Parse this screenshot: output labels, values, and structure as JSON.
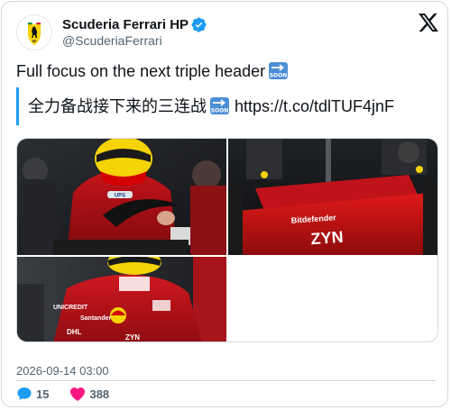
{
  "author": {
    "display_name": "Scuderia Ferrari HP",
    "handle": "@ScuderiaFerrari",
    "verified": true
  },
  "tweet": {
    "text": "Full focus on the next triple header",
    "text_emoji": "soon-arrow",
    "quote_text": "全力备战接下来的三连战",
    "quote_emoji": "soon-arrow",
    "link": "https://t.co/tdlTUF4jnF"
  },
  "media": {
    "car_livery": "Bitdefender",
    "car_sponsor": "ZYN",
    "suit_sponsors": [
      "Shell",
      "ZYN",
      "DHL"
    ]
  },
  "timestamp": "2026-09-14 03:00",
  "engagement": {
    "replies": "15",
    "likes": "388"
  },
  "colors": {
    "ferrari_red": "#d40000",
    "ferrari_yellow": "#f6d305",
    "link_blue": "#1d9bf0",
    "like_pink": "#f91880",
    "muted": "#536471"
  }
}
